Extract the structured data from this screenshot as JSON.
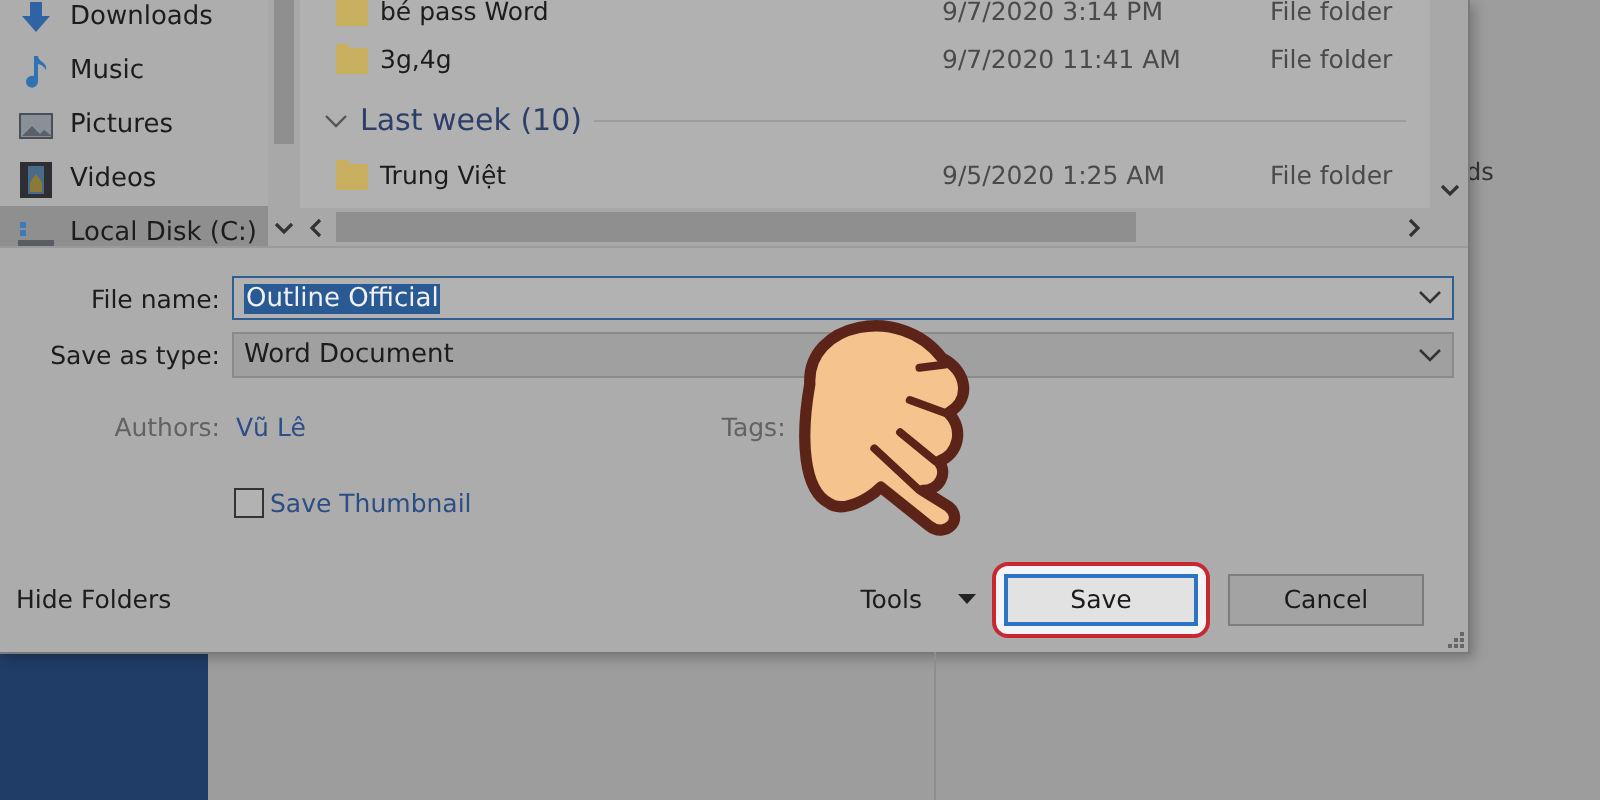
{
  "background": {
    "text_fragment": "ds"
  },
  "nav_pane": {
    "items": [
      {
        "label": "Downloads",
        "selected": false
      },
      {
        "label": "Music",
        "selected": false
      },
      {
        "label": "Pictures",
        "selected": false
      },
      {
        "label": "Videos",
        "selected": false
      },
      {
        "label": "Local Disk (C:)",
        "selected": true
      }
    ]
  },
  "file_list": {
    "items": [
      {
        "kind": "folder",
        "name": "bé pass Word",
        "date_modified": "9/7/2020 3:14 PM",
        "type": "File folder"
      },
      {
        "kind": "folder",
        "name": "3g,4g",
        "date_modified": "9/7/2020 11:41 AM",
        "type": "File folder"
      },
      {
        "kind": "group",
        "label": "Last week (10)",
        "expanded": true
      },
      {
        "kind": "folder",
        "name": "Trung Việt",
        "date_modified": "9/5/2020 1:25 AM",
        "type": "File folder"
      }
    ]
  },
  "form": {
    "file_name": {
      "label": "File name:",
      "value": "Outline Official",
      "text_selected": true
    },
    "save_as_type": {
      "label": "Save as type:",
      "value": "Word Document"
    },
    "authors": {
      "label": "Authors:",
      "value": "Vũ Lê"
    },
    "tags": {
      "label": "Tags:"
    },
    "save_thumbnail": {
      "label": "Save Thumbnail",
      "checked": false
    }
  },
  "footer": {
    "hide_folders": "Hide Folders",
    "tools": "Tools",
    "buttons": [
      {
        "label": "Save",
        "kind": "primary",
        "highlighted": true
      },
      {
        "label": "Cancel",
        "kind": "secondary",
        "highlighted": false
      }
    ]
  }
}
